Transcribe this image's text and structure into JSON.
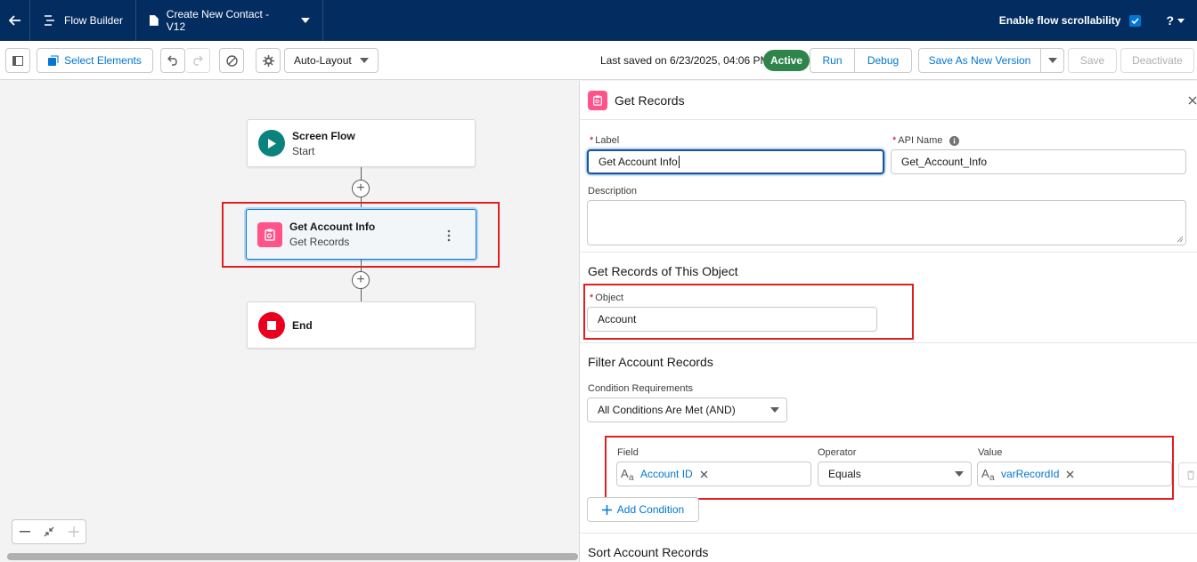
{
  "topbar": {
    "app_name": "Flow Builder",
    "flow_title": "Create New Contact - V12",
    "scroll_label": "Enable flow scrollability",
    "help": "?"
  },
  "toolbar": {
    "select_elements": "Select Elements",
    "layout": "Auto-Layout",
    "last_saved": "Last saved on 6/23/2025, 04:06 PM",
    "status_badge": "Active",
    "run": "Run",
    "debug": "Debug",
    "save_as_new_version": "Save As New Version",
    "save": "Save",
    "deactivate": "Deactivate"
  },
  "canvas": {
    "start": {
      "title": "Screen Flow",
      "subtitle": "Start"
    },
    "get_records": {
      "title": "Get Account Info",
      "subtitle": "Get Records"
    },
    "end": {
      "title": "End"
    }
  },
  "panel": {
    "title": "Get Records",
    "label_label": "Label",
    "label_value": "Get Account Info",
    "api_name_label": "API Name",
    "api_name_value": "Get_Account_Info",
    "description_label": "Description",
    "description_value": "",
    "object_section": "Get Records of This Object",
    "object_label": "Object",
    "object_value": "Account",
    "filter_section": "Filter Account Records",
    "condition_req_label": "Condition Requirements",
    "condition_req_value": "All Conditions Are Met (AND)",
    "field_header": "Field",
    "operator_header": "Operator",
    "value_header": "Value",
    "condition_field": "Account ID",
    "condition_operator": "Equals",
    "condition_value": "varRecordId",
    "add_condition": "Add Condition",
    "sort_section": "Sort Account Records"
  },
  "colors": {
    "header_bg": "#032d60",
    "brand_blue": "#0176d3",
    "active_green": "#2e844a",
    "start_teal": "#0b827c",
    "get_records_pink": "#ff538a",
    "end_red": "#ea001e",
    "highlight_red": "#e02020"
  }
}
